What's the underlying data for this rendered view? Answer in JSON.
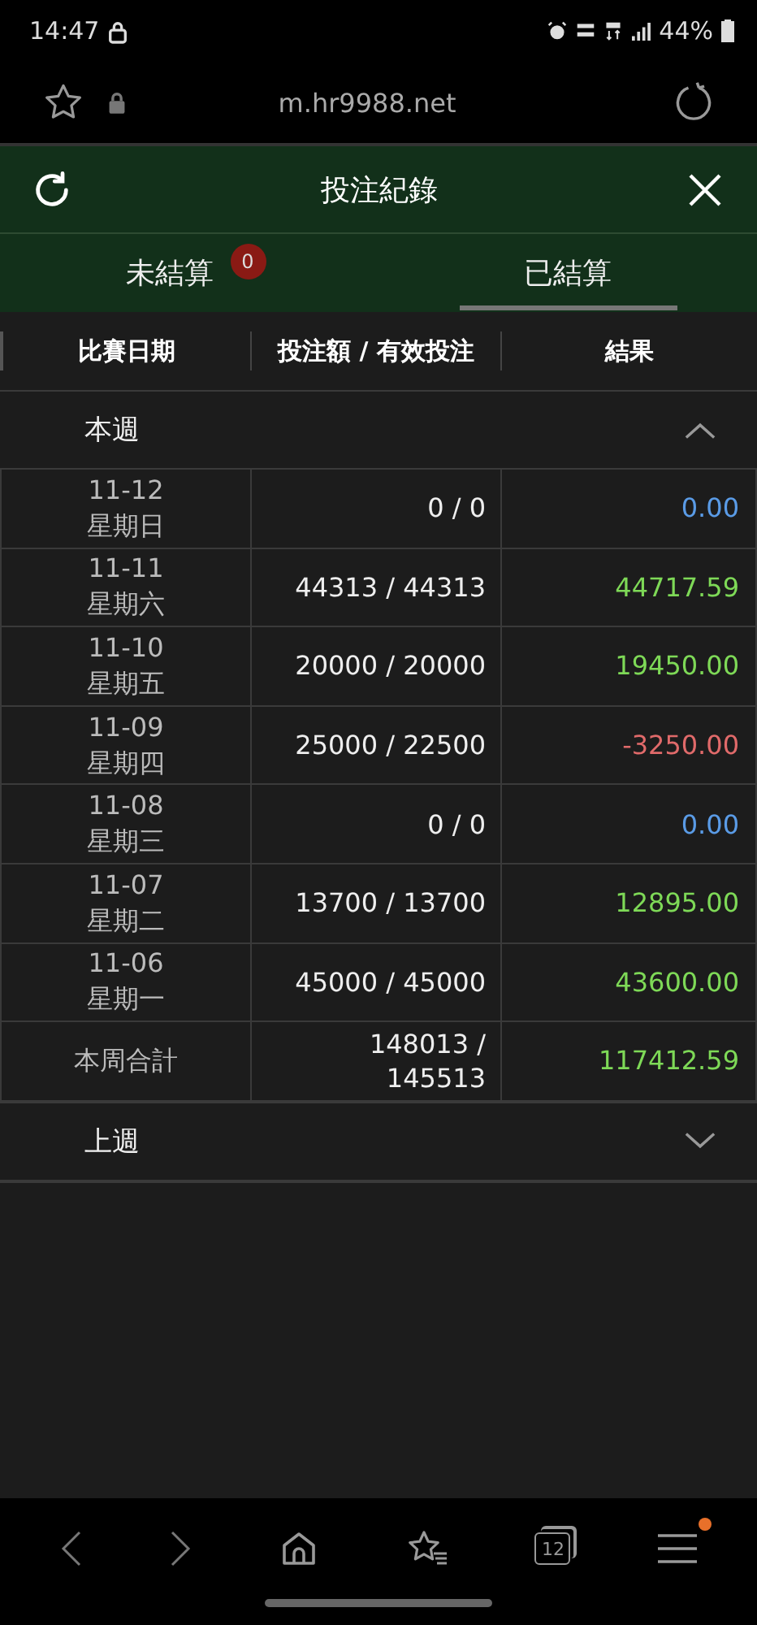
{
  "status_bar": {
    "time": "14:47",
    "battery": "44%"
  },
  "browser": {
    "url": "m.hr9988.net",
    "tab_count": "12",
    "menu_notification": true
  },
  "header": {
    "title": "投注紀錄"
  },
  "tabs": [
    {
      "label": "未結算",
      "badge": "0",
      "selected": false
    },
    {
      "label": "已結算",
      "selected": true
    }
  ],
  "table": {
    "columns": [
      "比賽日期",
      "投注額 / 有效投注",
      "結果"
    ],
    "sections": [
      {
        "title": "本週",
        "expanded": true,
        "rows": [
          {
            "date": "11-12",
            "weekday": "星期日",
            "amount": "0 / 0",
            "result": "0.00",
            "color": "#5a9be6"
          },
          {
            "date": "11-11",
            "weekday": "星期六",
            "amount": "44313 / 44313",
            "result": "44717.59",
            "color": "#7ed957"
          },
          {
            "date": "11-10",
            "weekday": "星期五",
            "amount": "20000 / 20000",
            "result": "19450.00",
            "color": "#7ed957"
          },
          {
            "date": "11-09",
            "weekday": "星期四",
            "amount": "25000 / 22500",
            "result": "-3250.00",
            "color": "#e06a6a"
          },
          {
            "date": "11-08",
            "weekday": "星期三",
            "amount": "0 / 0",
            "result": "0.00",
            "color": "#5a9be6"
          },
          {
            "date": "11-07",
            "weekday": "星期二",
            "amount": "13700 / 13700",
            "result": "12895.00",
            "color": "#7ed957"
          },
          {
            "date": "11-06",
            "weekday": "星期一",
            "amount": "45000 / 45000",
            "result": "43600.00",
            "color": "#7ed957"
          }
        ],
        "total": {
          "label": "本周合計",
          "amount": "148013 /\n145513",
          "result": "117412.59",
          "color": "#7ed957"
        }
      },
      {
        "title": "上週",
        "expanded": false
      }
    ]
  }
}
